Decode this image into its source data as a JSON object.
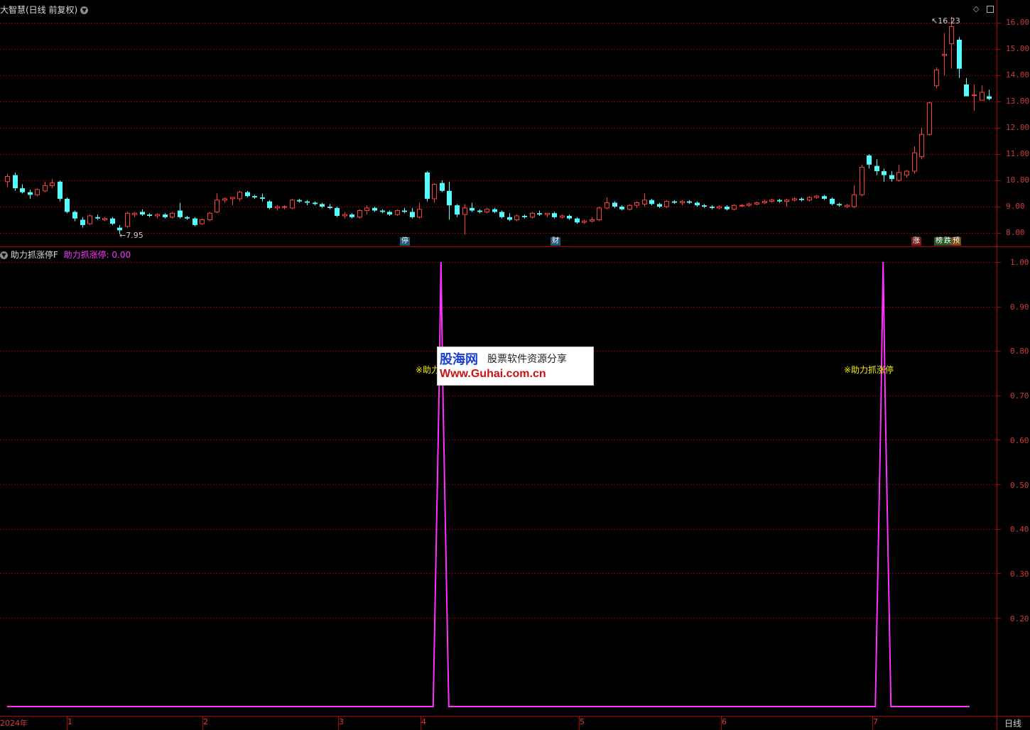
{
  "header": {
    "title": "大智慧(日线 前复权)",
    "max_label": "16.23",
    "min_label": "←7.95"
  },
  "price_axis": [
    "16.00",
    "15.00",
    "14.00",
    "13.00",
    "12.00",
    "11.00",
    "10.00",
    "9.00",
    "8.00"
  ],
  "markers": [
    "停",
    "财",
    "涨",
    "榜",
    "跌",
    "预"
  ],
  "indicator": {
    "name": "助力抓涨停F",
    "series_label": "助力抓涨停: 0.00",
    "axis": [
      "1.00",
      "0.90",
      "0.80",
      "0.70",
      "0.60",
      "0.50",
      "0.40",
      "0.30",
      "0.20"
    ],
    "signal_text": "※助力抓涨停",
    "signal_text_cut": "※助力",
    "line_color": "#ff33ff"
  },
  "time_axis": {
    "labels": [
      "2024年",
      "1",
      "2",
      "3",
      "4",
      "5",
      "6",
      "7"
    ],
    "period": "日线"
  },
  "watermark": {
    "brand": "股海网",
    "slogan": "股票软件资源分享",
    "url": "Www.Guhai.com.cn"
  },
  "colors": {
    "up": "#ff4040",
    "down": "#54ffff",
    "grid": "#800000",
    "frame": "#b00000"
  },
  "chart_data": [
    {
      "type": "candlestick",
      "title": "大智慧(日线 前复权)",
      "ylim": [
        7.7,
        16.7
      ],
      "y_ticks": [
        8,
        9,
        10,
        11,
        12,
        13,
        14,
        15,
        16
      ],
      "annotations": [
        "16.23",
        "←7.95"
      ],
      "candles": [
        [
          9.95,
          10.25,
          9.75,
          10.15
        ],
        [
          10.2,
          10.3,
          9.6,
          9.7
        ],
        [
          9.7,
          9.85,
          9.5,
          9.55
        ],
        [
          9.55,
          9.65,
          9.3,
          9.45
        ],
        [
          9.45,
          9.7,
          9.4,
          9.65
        ],
        [
          9.6,
          9.95,
          9.55,
          9.8
        ],
        [
          9.8,
          10.05,
          9.7,
          9.9
        ],
        [
          9.95,
          10.0,
          9.2,
          9.3
        ],
        [
          9.3,
          9.35,
          8.75,
          8.8
        ],
        [
          8.8,
          8.85,
          8.45,
          8.55
        ],
        [
          8.5,
          8.6,
          8.2,
          8.3
        ],
        [
          8.35,
          8.7,
          8.3,
          8.65
        ],
        [
          8.6,
          8.7,
          8.5,
          8.55
        ],
        [
          8.5,
          8.6,
          8.45,
          8.55
        ],
        [
          8.55,
          8.6,
          8.3,
          8.35
        ],
        [
          8.2,
          8.3,
          7.95,
          8.1
        ],
        [
          8.25,
          8.8,
          8.2,
          8.75
        ],
        [
          8.7,
          8.8,
          8.6,
          8.75
        ],
        [
          8.8,
          8.9,
          8.65,
          8.7
        ],
        [
          8.7,
          8.75,
          8.6,
          8.65
        ],
        [
          8.65,
          8.75,
          8.55,
          8.7
        ],
        [
          8.7,
          8.75,
          8.55,
          8.6
        ],
        [
          8.6,
          8.8,
          8.55,
          8.75
        ],
        [
          8.85,
          9.15,
          8.55,
          8.6
        ],
        [
          8.6,
          8.65,
          8.5,
          8.55
        ],
        [
          8.55,
          8.6,
          8.25,
          8.3
        ],
        [
          8.35,
          8.55,
          8.3,
          8.5
        ],
        [
          8.5,
          8.8,
          8.45,
          8.75
        ],
        [
          8.8,
          9.5,
          8.75,
          9.25
        ],
        [
          9.25,
          9.35,
          9.15,
          9.3
        ],
        [
          9.3,
          9.35,
          9.05,
          9.35
        ],
        [
          9.3,
          9.6,
          9.2,
          9.55
        ],
        [
          9.55,
          9.6,
          9.35,
          9.4
        ],
        [
          9.4,
          9.45,
          9.3,
          9.35
        ],
        [
          9.35,
          9.5,
          9.2,
          9.3
        ],
        [
          9.2,
          9.25,
          8.9,
          8.95
        ],
        [
          8.95,
          9.05,
          8.85,
          9.0
        ],
        [
          9.0,
          9.05,
          8.9,
          9.0
        ],
        [
          8.95,
          9.3,
          8.9,
          9.25
        ],
        [
          9.25,
          9.3,
          9.15,
          9.2
        ],
        [
          9.2,
          9.25,
          9.05,
          9.15
        ],
        [
          9.15,
          9.2,
          9.05,
          9.1
        ],
        [
          9.1,
          9.15,
          8.95,
          9.0
        ],
        [
          9.0,
          9.1,
          8.9,
          8.95
        ],
        [
          8.95,
          9.0,
          8.6,
          8.65
        ],
        [
          8.65,
          8.8,
          8.55,
          8.7
        ],
        [
          8.7,
          8.75,
          8.55,
          8.6
        ],
        [
          8.6,
          8.9,
          8.55,
          8.85
        ],
        [
          8.85,
          9.05,
          8.7,
          8.95
        ],
        [
          8.95,
          9.0,
          8.8,
          8.85
        ],
        [
          8.85,
          8.9,
          8.75,
          8.8
        ],
        [
          8.8,
          8.85,
          8.65,
          8.7
        ],
        [
          8.7,
          8.9,
          8.65,
          8.85
        ],
        [
          8.85,
          8.95,
          8.75,
          8.8
        ],
        [
          8.8,
          8.95,
          8.55,
          8.6
        ],
        [
          8.6,
          9.15,
          8.55,
          8.9
        ],
        [
          10.3,
          10.35,
          9.2,
          9.3
        ],
        [
          9.3,
          9.9,
          9.15,
          9.85
        ],
        [
          9.9,
          10.0,
          9.55,
          9.6
        ],
        [
          9.6,
          9.95,
          8.5,
          9.05
        ],
        [
          9.05,
          9.1,
          8.6,
          8.7
        ],
        [
          8.7,
          9.1,
          7.95,
          8.95
        ],
        [
          8.95,
          9.15,
          8.8,
          8.85
        ],
        [
          8.85,
          8.9,
          8.75,
          8.8
        ],
        [
          8.8,
          8.95,
          8.75,
          8.9
        ],
        [
          8.9,
          8.95,
          8.75,
          8.8
        ],
        [
          8.8,
          8.85,
          8.55,
          8.6
        ],
        [
          8.6,
          8.75,
          8.45,
          8.5
        ],
        [
          8.5,
          8.7,
          8.45,
          8.65
        ],
        [
          8.65,
          8.7,
          8.55,
          8.6
        ],
        [
          8.6,
          8.8,
          8.55,
          8.75
        ],
        [
          8.75,
          8.85,
          8.65,
          8.7
        ],
        [
          8.7,
          8.75,
          8.6,
          8.75
        ],
        [
          8.75,
          8.8,
          8.55,
          8.6
        ],
        [
          8.6,
          8.7,
          8.55,
          8.65
        ],
        [
          8.65,
          8.7,
          8.5,
          8.55
        ],
        [
          8.55,
          8.6,
          8.35,
          8.4
        ],
        [
          8.4,
          8.5,
          8.35,
          8.45
        ],
        [
          8.45,
          8.6,
          8.4,
          8.5
        ],
        [
          8.5,
          9.0,
          8.45,
          8.95
        ],
        [
          8.95,
          9.35,
          8.9,
          9.15
        ],
        [
          9.15,
          9.2,
          8.95,
          9.0
        ],
        [
          9.0,
          9.05,
          8.85,
          8.9
        ],
        [
          8.9,
          9.1,
          8.85,
          9.05
        ],
        [
          9.05,
          9.2,
          8.95,
          9.15
        ],
        [
          9.1,
          9.5,
          9.0,
          9.25
        ],
        [
          9.25,
          9.3,
          9.05,
          9.1
        ],
        [
          9.1,
          9.15,
          8.95,
          9.0
        ],
        [
          9.0,
          9.25,
          8.95,
          9.2
        ],
        [
          9.2,
          9.25,
          9.1,
          9.15
        ],
        [
          9.15,
          9.25,
          9.05,
          9.2
        ],
        [
          9.2,
          9.25,
          9.1,
          9.15
        ],
        [
          9.15,
          9.2,
          9.0,
          9.05
        ],
        [
          9.05,
          9.1,
          8.95,
          9.0
        ],
        [
          9.0,
          9.05,
          8.9,
          8.95
        ],
        [
          8.95,
          9.05,
          8.9,
          9.0
        ],
        [
          9.0,
          9.05,
          8.85,
          8.9
        ],
        [
          8.9,
          9.1,
          8.85,
          9.05
        ],
        [
          9.05,
          9.1,
          9.0,
          9.05
        ],
        [
          9.05,
          9.15,
          9.0,
          9.1
        ],
        [
          9.1,
          9.2,
          9.05,
          9.15
        ],
        [
          9.15,
          9.25,
          9.1,
          9.2
        ],
        [
          9.2,
          9.3,
          9.15,
          9.25
        ],
        [
          9.25,
          9.3,
          9.15,
          9.2
        ],
        [
          9.2,
          9.3,
          9.0,
          9.25
        ],
        [
          9.25,
          9.35,
          9.2,
          9.3
        ],
        [
          9.3,
          9.35,
          9.2,
          9.25
        ],
        [
          9.25,
          9.4,
          9.2,
          9.35
        ],
        [
          9.35,
          9.45,
          9.3,
          9.4
        ],
        [
          9.4,
          9.45,
          9.25,
          9.3
        ],
        [
          9.3,
          9.35,
          9.05,
          9.1
        ],
        [
          9.1,
          9.15,
          9.0,
          9.05
        ],
        [
          9.0,
          9.1,
          8.95,
          9.05
        ],
        [
          9.0,
          9.8,
          8.95,
          9.45
        ],
        [
          9.45,
          10.6,
          9.4,
          10.5
        ],
        [
          10.95,
          11.0,
          10.45,
          10.6
        ],
        [
          10.55,
          10.8,
          10.2,
          10.35
        ],
        [
          10.35,
          10.45,
          9.95,
          10.2
        ],
        [
          10.2,
          10.35,
          9.95,
          10.05
        ],
        [
          10.0,
          10.6,
          9.95,
          10.3
        ],
        [
          10.2,
          10.4,
          10.1,
          10.35
        ],
        [
          10.35,
          11.3,
          10.25,
          11.05
        ],
        [
          10.9,
          12.0,
          10.8,
          11.75
        ],
        [
          11.75,
          13.0,
          11.7,
          12.95
        ],
        [
          13.6,
          14.3,
          13.5,
          14.2
        ],
        [
          14.75,
          15.6,
          14.0,
          14.8
        ],
        [
          15.2,
          16.23,
          14.25,
          15.85
        ],
        [
          15.35,
          15.45,
          13.9,
          14.25
        ],
        [
          13.65,
          13.9,
          13.25,
          13.2
        ],
        [
          13.25,
          13.65,
          12.65,
          13.25
        ],
        [
          13.05,
          13.6,
          13.05,
          13.35
        ],
        [
          13.2,
          13.45,
          13.05,
          13.1
        ]
      ]
    },
    {
      "type": "line",
      "series": [
        {
          "name": "助力抓涨停"
        }
      ],
      "ylim": [
        0,
        1
      ],
      "y_ticks": [
        0.2,
        0.3,
        0.4,
        0.5,
        0.6,
        0.7,
        0.8,
        0.9,
        1.0
      ],
      "signal_bars": [
        56,
        115
      ],
      "values_note": "0 everywhere except 1 at the two signal bars",
      "last_value": 0.0
    }
  ]
}
